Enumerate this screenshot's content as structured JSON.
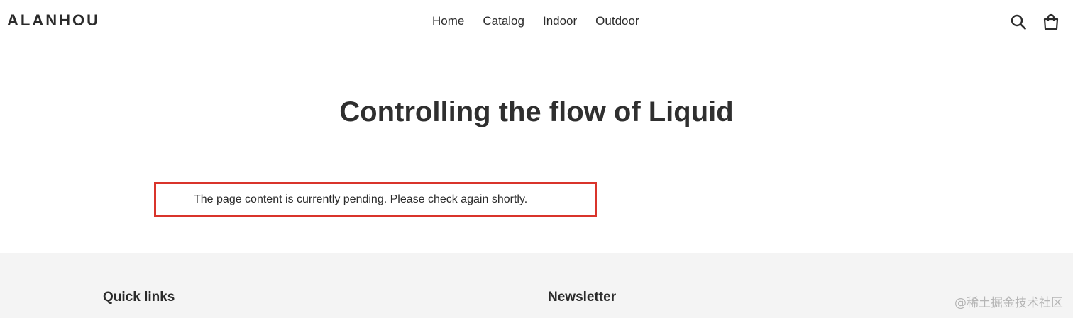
{
  "header": {
    "logo": "ALANHOU",
    "nav": [
      {
        "label": "Home"
      },
      {
        "label": "Catalog"
      },
      {
        "label": "Indoor"
      },
      {
        "label": "Outdoor"
      }
    ],
    "icons": {
      "search": "search-icon",
      "cart": "cart-icon"
    }
  },
  "main": {
    "title": "Controlling the flow of Liquid",
    "content": "The page content is currently pending. Please check again shortly.",
    "highlight_color": "#d9342b"
  },
  "footer": {
    "quick_links": "Quick links",
    "newsletter": "Newsletter",
    "background": "#f4f4f4"
  },
  "watermark": "@稀土掘金技术社区"
}
